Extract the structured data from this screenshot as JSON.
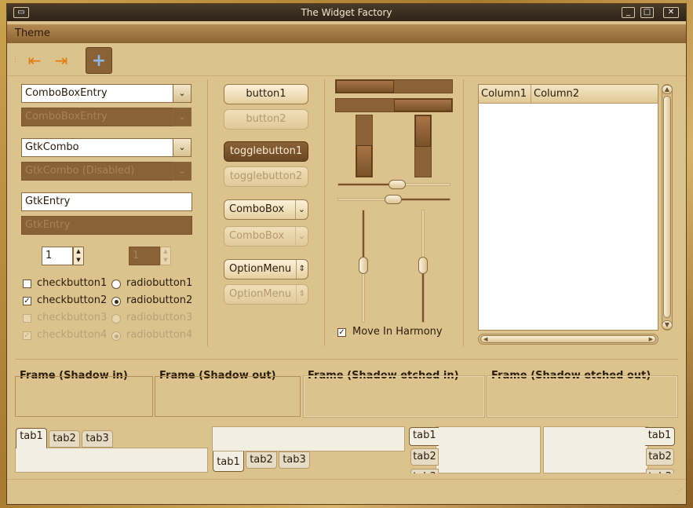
{
  "window": {
    "title": "The Widget Factory"
  },
  "menu": {
    "theme": "Theme"
  },
  "toolbar": {
    "back_icon": "back-arrow-icon",
    "forward_icon": "forward-arrow-icon",
    "add_icon": "plus-icon"
  },
  "col1": {
    "combo_entry": "ComboBoxEntry",
    "combo_entry_dis": "ComboBoxEntry",
    "gtk_combo": "GtkCombo",
    "gtk_combo_dis": "GtkCombo (Disabled)",
    "entry": "GtkEntry",
    "entry_dis": "GtkEntry",
    "spin": "1",
    "spin_dis": "1",
    "check1": "checkbutton1",
    "check2": "checkbutton2",
    "check3": "checkbutton3",
    "check4": "checkbutton4",
    "radio1": "radiobutton1",
    "radio2": "radiobutton2",
    "radio3": "radiobutton3",
    "radio4": "radiobutton4"
  },
  "col2": {
    "button1": "button1",
    "button2": "button2",
    "toggle1": "togglebutton1",
    "toggle2": "togglebutton2",
    "combobox": "ComboBox",
    "combobox_dis": "ComboBox",
    "option": "OptionMenu",
    "option_dis": "OptionMenu"
  },
  "col3": {
    "move_harmony": "Move In Harmony"
  },
  "tree": {
    "col1": "Column1",
    "col2": "Column2"
  },
  "frames": {
    "in": "Frame (Shadow in)",
    "out": "Frame (Shadow out)",
    "etched_in": "Frame (Shadow etched in)",
    "etched_out": "Frame (Shadow etched out)"
  },
  "notebooks": {
    "tab1": "tab1",
    "tab2": "tab2",
    "tab3": "tab3"
  }
}
